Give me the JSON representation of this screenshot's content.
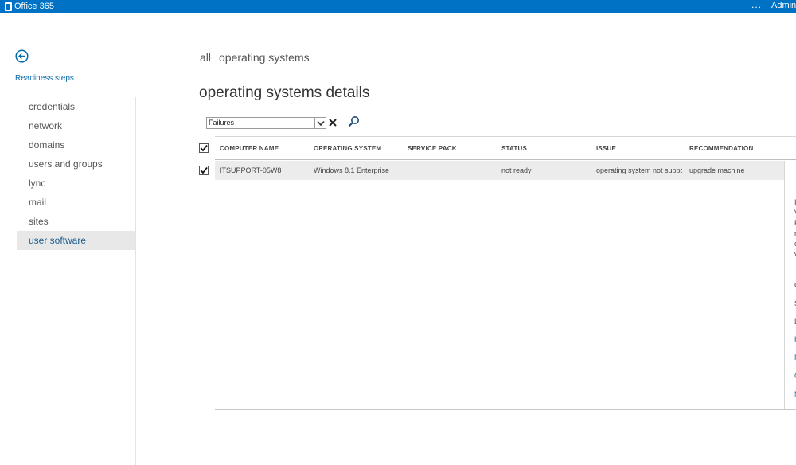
{
  "topbar": {
    "brand": "Office 365",
    "more_label": "...",
    "user_label": "Admin"
  },
  "sidebar": {
    "title": "Readiness steps",
    "items": [
      {
        "label": "credentials"
      },
      {
        "label": "network"
      },
      {
        "label": "domains"
      },
      {
        "label": "users and groups"
      },
      {
        "label": "lync"
      },
      {
        "label": "mail"
      },
      {
        "label": "sites"
      },
      {
        "label": "user software",
        "active": true
      }
    ]
  },
  "breadcrumb": [
    "all",
    "operating systems"
  ],
  "page_title": "operating systems details",
  "filter": {
    "value": "Failures"
  },
  "table": {
    "columns": [
      "COMPUTER NAME",
      "OPERATING SYSTEM",
      "SERVICE PACK",
      "STATUS",
      "ISSUE",
      "RECOMMENDATION"
    ],
    "rows": [
      {
        "selected": true,
        "cells": [
          "ITSUPPORT-05W8",
          "Windows 8.1 Enterprise",
          "",
          "not ready",
          "operating system not supported",
          "upgrade machine"
        ]
      }
    ]
  },
  "details_pane": {
    "text_lines": [
      "I",
      "V",
      "F",
      "r",
      "c",
      "v"
    ],
    "fields": [
      "C",
      "S",
      "L"
    ],
    "links": [
      "H",
      "F",
      "C",
      "N"
    ]
  },
  "colors": {
    "topbar": "#0072c6",
    "link": "#0a6aa8",
    "selected_row": "#ececec",
    "active_nav": "#e8e8e8"
  }
}
